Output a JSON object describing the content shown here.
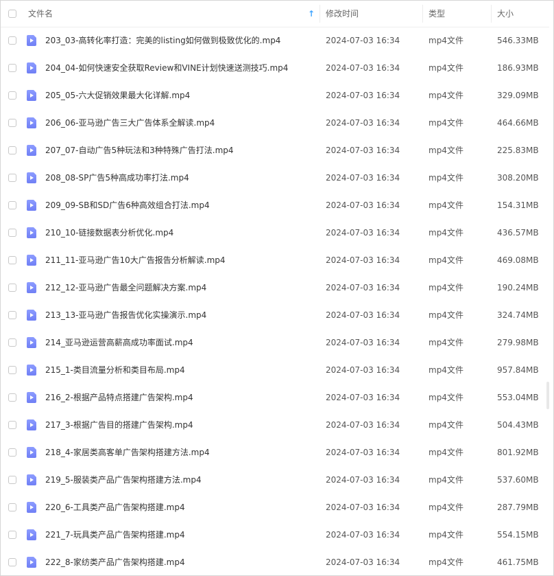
{
  "header": {
    "name": "文件名",
    "modified": "修改时间",
    "type": "类型",
    "size": "大小",
    "sort_icon": "↑"
  },
  "files": [
    {
      "name": "203_03-高转化率打造：完美的listing如何做到极致优化的.mp4",
      "time": "2024-07-03 16:34",
      "type": "mp4文件",
      "size": "546.33MB"
    },
    {
      "name": "204_04-如何快速安全获取Review和VINE计划快速送测技巧.mp4",
      "time": "2024-07-03 16:34",
      "type": "mp4文件",
      "size": "186.93MB"
    },
    {
      "name": "205_05-六大促销效果最大化详解.mp4",
      "time": "2024-07-03 16:34",
      "type": "mp4文件",
      "size": "329.09MB"
    },
    {
      "name": "206_06-亚马逊广告三大广告体系全解读.mp4",
      "time": "2024-07-03 16:34",
      "type": "mp4文件",
      "size": "464.66MB"
    },
    {
      "name": "207_07-自动广告5种玩法和3种特殊广告打法.mp4",
      "time": "2024-07-03 16:34",
      "type": "mp4文件",
      "size": "225.83MB"
    },
    {
      "name": "208_08-SP广告5种高成功率打法.mp4",
      "time": "2024-07-03 16:34",
      "type": "mp4文件",
      "size": "308.20MB"
    },
    {
      "name": "209_09-SB和SD广告6种高效组合打法.mp4",
      "time": "2024-07-03 16:34",
      "type": "mp4文件",
      "size": "154.31MB"
    },
    {
      "name": "210_10-链接数据表分析优化.mp4",
      "time": "2024-07-03 16:34",
      "type": "mp4文件",
      "size": "436.57MB"
    },
    {
      "name": "211_11-亚马逊广告10大广告报告分析解读.mp4",
      "time": "2024-07-03 16:34",
      "type": "mp4文件",
      "size": "469.08MB"
    },
    {
      "name": "212_12-亚马逊广告最全问题解决方案.mp4",
      "time": "2024-07-03 16:34",
      "type": "mp4文件",
      "size": "190.24MB"
    },
    {
      "name": "213_13-亚马逊广告报告优化实操演示.mp4",
      "time": "2024-07-03 16:34",
      "type": "mp4文件",
      "size": "324.74MB"
    },
    {
      "name": "214_亚马逊运营高薪高成功率面试.mp4",
      "time": "2024-07-03 16:34",
      "type": "mp4文件",
      "size": "279.98MB"
    },
    {
      "name": "215_1-类目流量分析和类目布局.mp4",
      "time": "2024-07-03 16:34",
      "type": "mp4文件",
      "size": "957.84MB"
    },
    {
      "name": "216_2-根据产品特点搭建广告架构.mp4",
      "time": "2024-07-03 16:34",
      "type": "mp4文件",
      "size": "553.04MB"
    },
    {
      "name": "217_3-根据广告目的搭建广告架构.mp4",
      "time": "2024-07-03 16:34",
      "type": "mp4文件",
      "size": "504.43MB"
    },
    {
      "name": "218_4-家居类高客单广告架构搭建方法.mp4",
      "time": "2024-07-03 16:34",
      "type": "mp4文件",
      "size": "801.92MB"
    },
    {
      "name": "219_5-服装类产品广告架构搭建方法.mp4",
      "time": "2024-07-03 16:34",
      "type": "mp4文件",
      "size": "537.60MB"
    },
    {
      "name": "220_6-工具类产品广告架构搭建.mp4",
      "time": "2024-07-03 16:34",
      "type": "mp4文件",
      "size": "287.79MB"
    },
    {
      "name": "221_7-玩具类产品广告架构搭建.mp4",
      "time": "2024-07-03 16:34",
      "type": "mp4文件",
      "size": "554.15MB"
    },
    {
      "name": "222_8-家纺类产品广告架构搭建.mp4",
      "time": "2024-07-03 16:34",
      "type": "mp4文件",
      "size": "461.75MB"
    }
  ]
}
